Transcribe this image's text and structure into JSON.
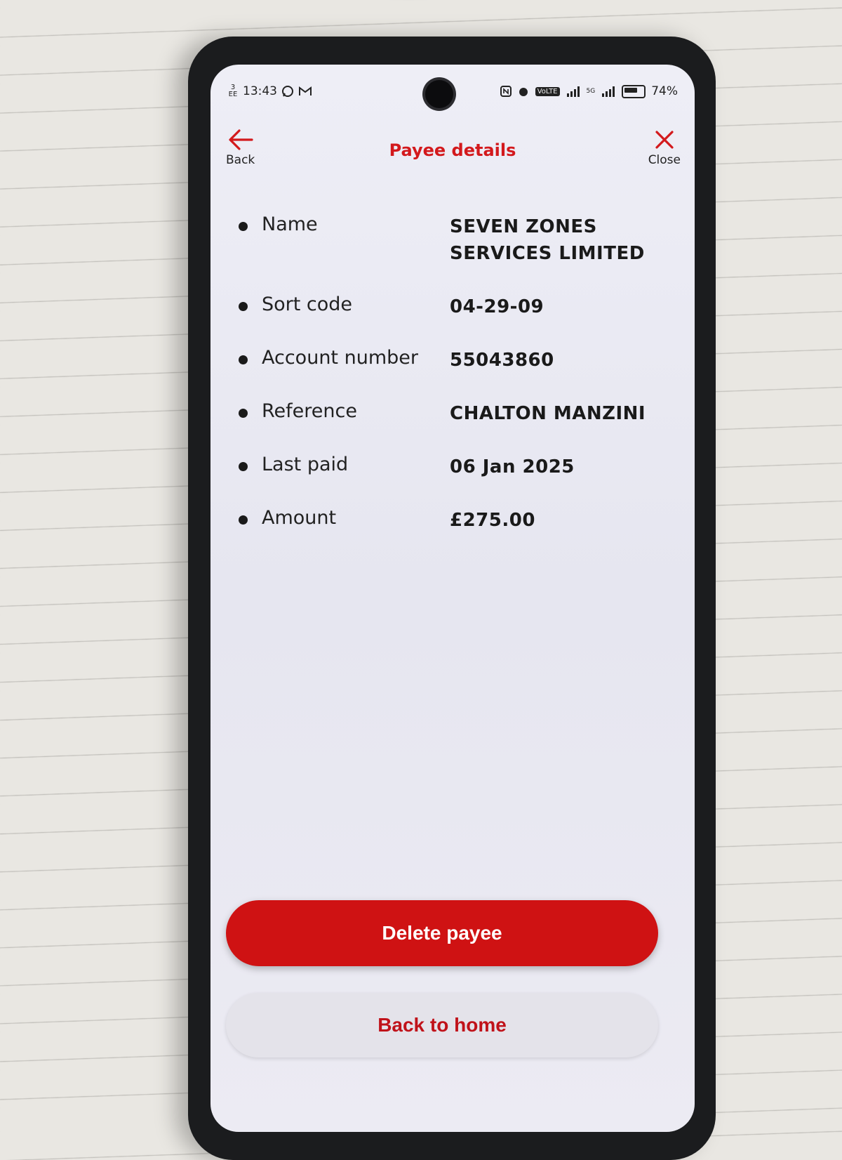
{
  "status_bar": {
    "carrier_top": "3",
    "carrier_bottom": "EE",
    "time": "13:43",
    "volte": "VoLTE",
    "network": "5G",
    "battery": "74%"
  },
  "header": {
    "back_label": "Back",
    "title": "Payee details",
    "close_label": "Close"
  },
  "details": [
    {
      "label": "Name",
      "value": "SEVEN ZONES SERVICES LIMITED"
    },
    {
      "label": "Sort code",
      "value": "04-29-09"
    },
    {
      "label": "Account number",
      "value": "55043860"
    },
    {
      "label": "Reference",
      "value": "CHALTON MANZINI"
    },
    {
      "label": "Last paid",
      "value": "06 Jan 2025"
    },
    {
      "label": "Amount",
      "value": "£275.00"
    }
  ],
  "actions": {
    "delete_label": "Delete payee",
    "home_label": "Back to home"
  },
  "colors": {
    "accent": "#d3191c",
    "button_red": "#cf1213"
  }
}
